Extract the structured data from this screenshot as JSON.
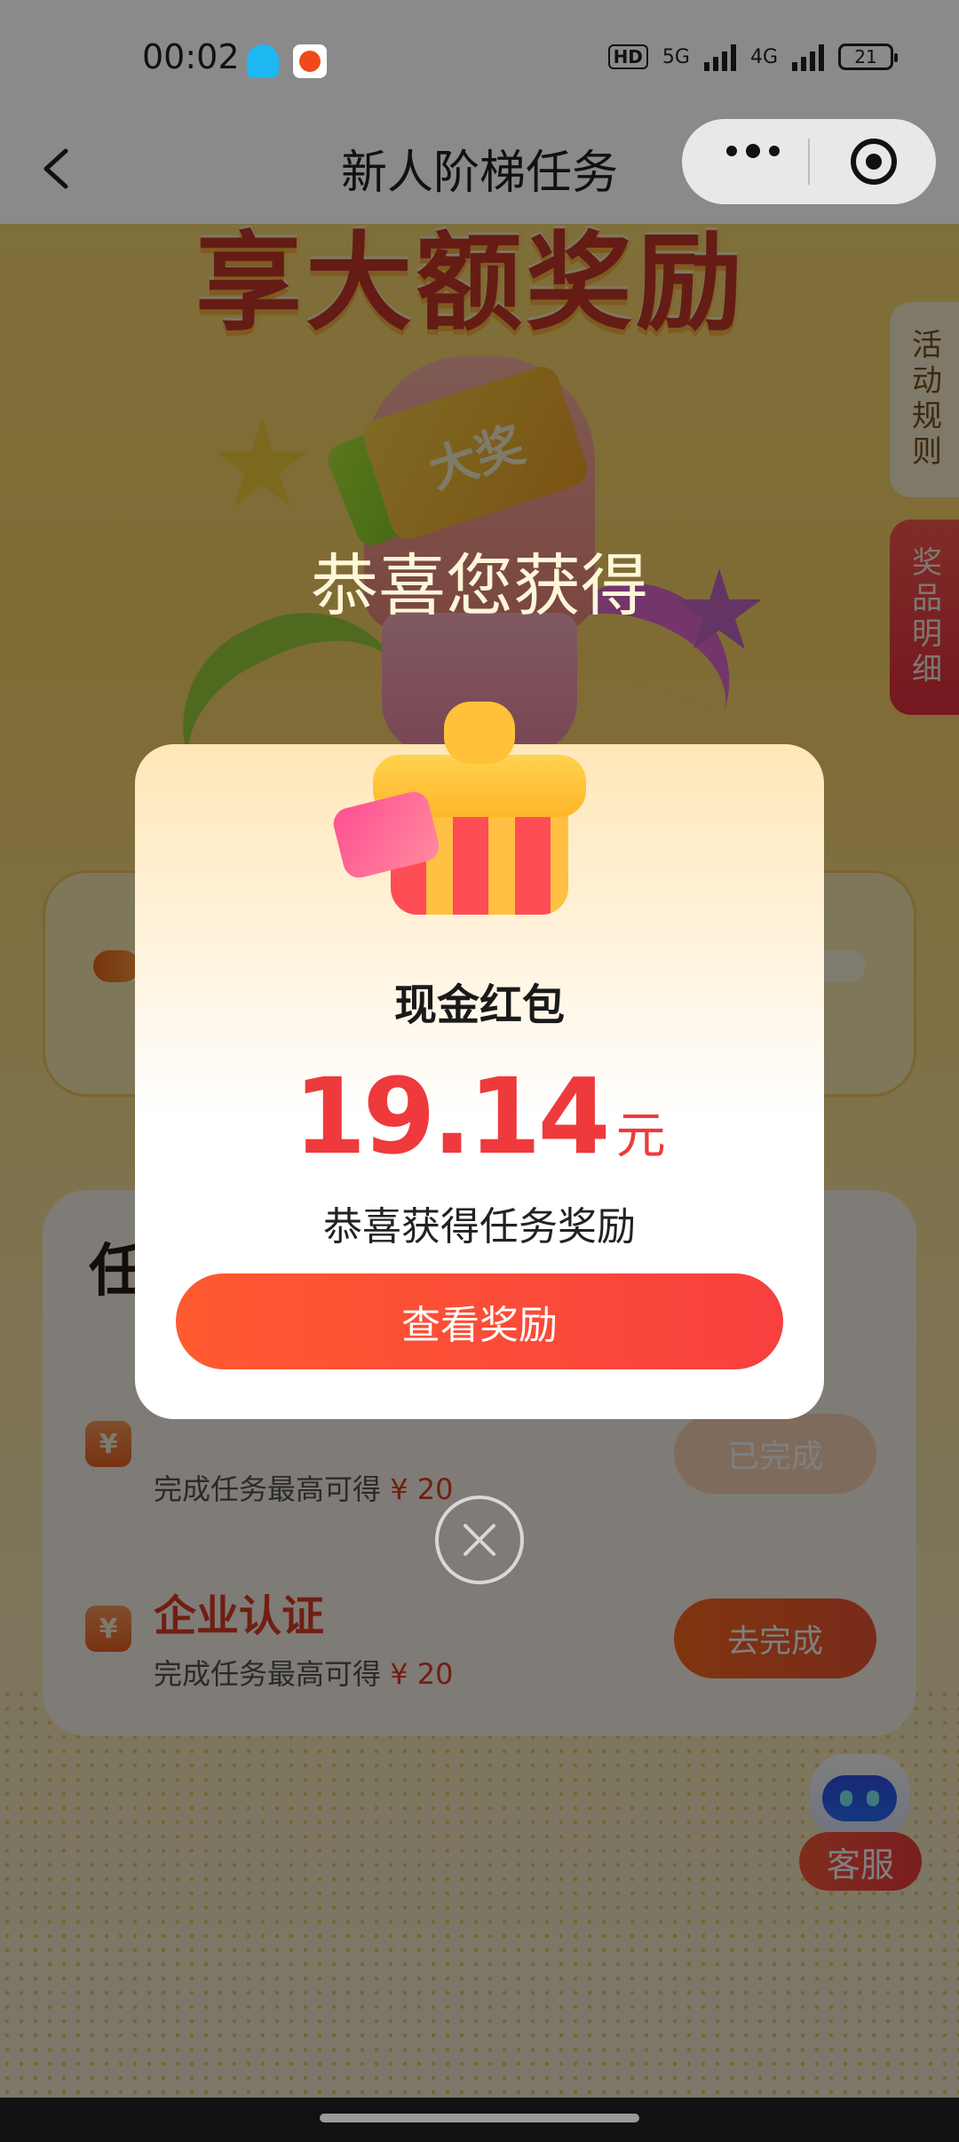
{
  "status_bar": {
    "time": "00:02",
    "network": [
      "HD",
      "5G",
      "4G"
    ],
    "battery": "21"
  },
  "nav": {
    "title": "新人阶梯任务",
    "back_icon": "chevron-left-icon",
    "more_icon": "more-dots-icon",
    "close_icon": "target-icon"
  },
  "banner": {
    "headline": "享大额奖励",
    "ticket_text": "大奖"
  },
  "side_tabs": {
    "rules": "活动规则",
    "prizes": "奖品明细"
  },
  "progress": {
    "fill_fraction": 0.06
  },
  "tasks": {
    "title": "任",
    "items": [
      {
        "name": "",
        "desc": "完成任务最高可得",
        "amount": "¥ 20",
        "button": "已完成",
        "status": "done"
      },
      {
        "name": "企业认证",
        "desc": "完成任务最高可得",
        "amount": "¥ 20",
        "button": "去完成",
        "status": "todo"
      }
    ]
  },
  "customer_service": {
    "label": "客服"
  },
  "dialog": {
    "congrats": "恭喜您获得",
    "prize_name": "现金红包",
    "amount": "19.14",
    "unit": "元",
    "desc": "恭喜获得任务奖励",
    "button": "查看奖励"
  },
  "colors": {
    "accent_red": "#ee3a3c",
    "button_gradient_start": "#ff5a30",
    "button_gradient_end": "#f7403f"
  }
}
